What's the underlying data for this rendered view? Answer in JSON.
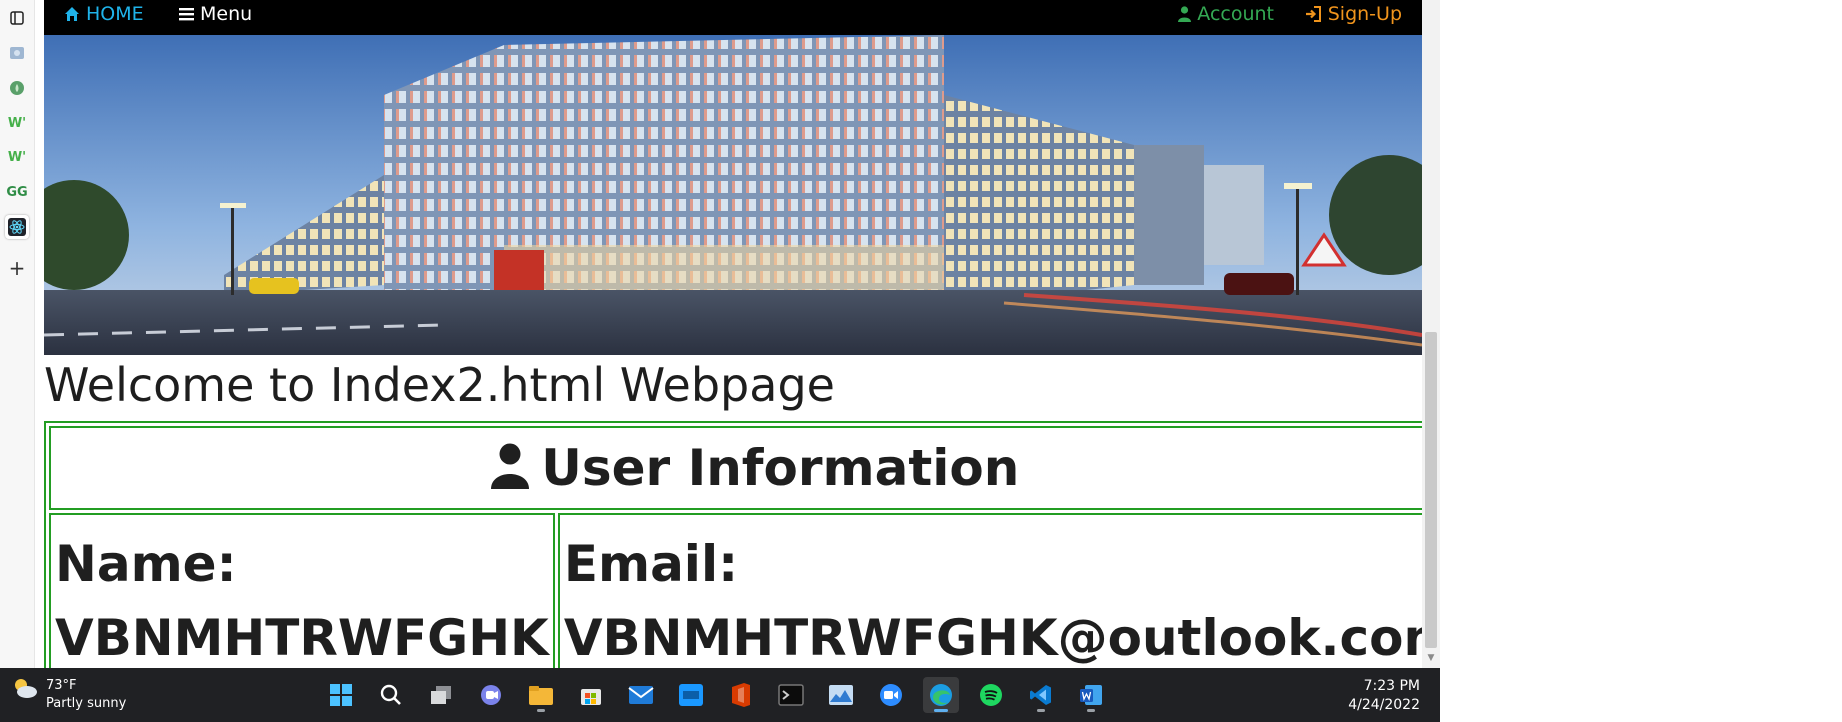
{
  "navbar": {
    "home_label": "HOME",
    "menu_label": "Menu",
    "account_label": "Account",
    "signup_label": "Sign-Up"
  },
  "page": {
    "heading": "Welcome to Index2.html Webpage"
  },
  "user_table": {
    "header": "User Information",
    "name_label": "Name:",
    "name_value": "VBNMHTRWFGHK",
    "email_label": "Email:",
    "email_value": "VBNMHTRWFGHK@outlook.com"
  },
  "sidebar": {
    "icons": [
      "tab-actions-icon",
      "gallery-icon",
      "plant-icon",
      "w-logo-icon",
      "w-logo-icon",
      "infinity-icon",
      "react-icon",
      "add-icon"
    ]
  },
  "taskbar": {
    "weather": {
      "temp": "73°F",
      "condition": "Partly sunny"
    },
    "time": "7:23 PM",
    "date": "4/24/2022",
    "apps": [
      "windows-start-icon",
      "search-icon",
      "task-view-icon",
      "chat-icon",
      "file-explorer-icon",
      "store-icon",
      "mail-icon",
      "prime-video-icon",
      "office-icon",
      "terminal-icon",
      "photos-icon",
      "zoom-icon",
      "edge-icon",
      "spotify-icon",
      "vscode-icon",
      "word-icon"
    ]
  },
  "colors": {
    "navbar_bg": "#000000",
    "home_link": "#1fb3ea",
    "account_link": "#34a853",
    "signup_link": "#f0941c",
    "table_border": "#239d23",
    "taskbar_bg": "#202124"
  }
}
